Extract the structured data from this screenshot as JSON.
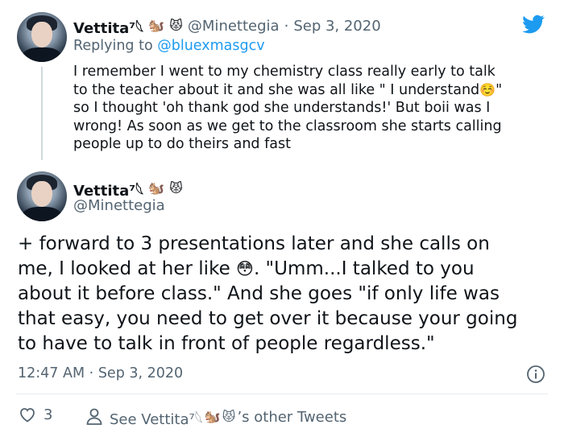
{
  "tweet1": {
    "display_name": "Vettita⁷𓆩",
    "name_emojis": [
      "🐿️",
      "😾"
    ],
    "handle": "@Minettegia",
    "separator": "·",
    "date": "Sep 3, 2020",
    "replying_prefix": "Replying to",
    "replying_to": "@bluexmasgcv",
    "lines": [
      "I remember I went to my chemistry class really early to talk",
      "to the teacher about it and she was all like \" I understand",
      "so I thought 'oh thank god she understands!' But boii was I",
      "wrong! As soon as we get to the classroom she starts calling",
      "people up to do theirs and fast"
    ],
    "line2_emoji": "☺️",
    "line2_end": "\""
  },
  "tweet2": {
    "display_name": "Vettita⁷𓆩",
    "name_emojis": [
      "🐿️",
      "😾"
    ],
    "handle": "@Minettegia",
    "lines": [
      "+ forward to 3 presentations later and she calls on",
      "me, I looked at her like",
      "about it before class.\" And she goes \"if only life was",
      "that easy, you need to get over it because your going",
      "to have to talk in front of people regardless.\""
    ],
    "line2_emoji": "😳",
    "line2_rest": ". \"Umm...I talked to you",
    "time": "12:47 AM",
    "separator": "·",
    "date": "Sep 3, 2020"
  },
  "actions": {
    "like_count": "3",
    "see_prefix": "See Vettita⁷𓆩",
    "see_suffix": "’s other Tweets",
    "see_emojis": [
      "🐿️",
      "😾"
    ]
  },
  "colors": {
    "twitter_blue": "#1d9bf0",
    "text": "#0f1419",
    "muted": "#536471"
  },
  "icons": [
    "twitter-bird-icon",
    "info-icon",
    "heart-icon",
    "person-icon"
  ]
}
